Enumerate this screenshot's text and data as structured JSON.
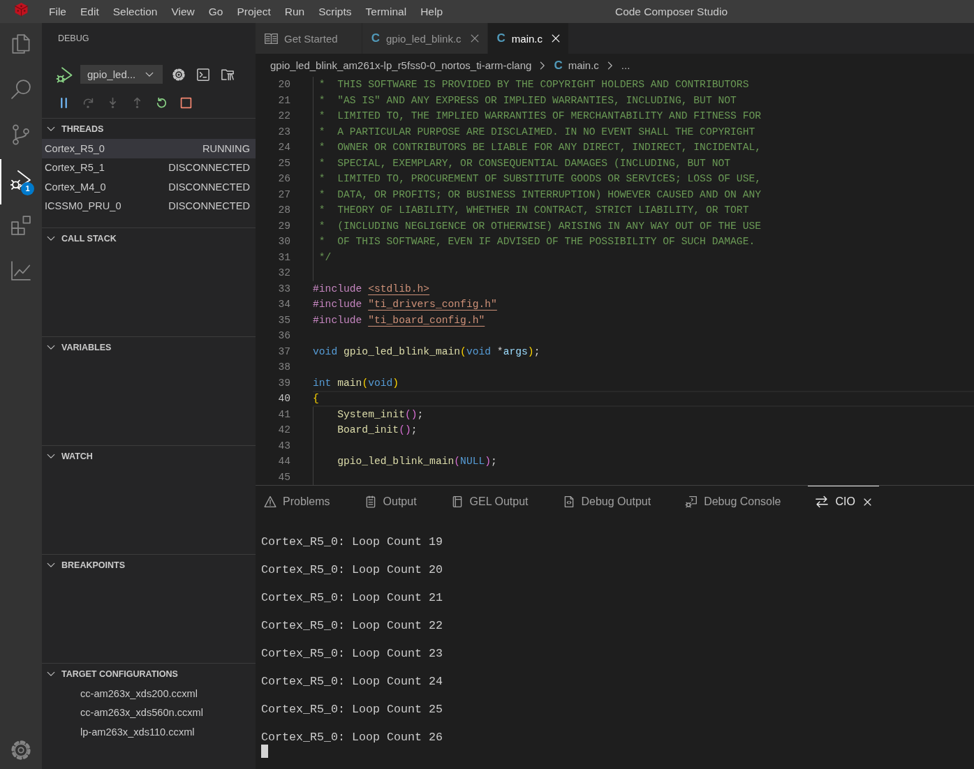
{
  "window": {
    "title": "Code Composer Studio"
  },
  "menu": [
    "File",
    "Edit",
    "Selection",
    "View",
    "Go",
    "Project",
    "Run",
    "Scripts",
    "Terminal",
    "Help"
  ],
  "activity_bar": {
    "items": [
      {
        "kind": "explorer",
        "selected": false
      },
      {
        "kind": "search",
        "selected": false
      },
      {
        "kind": "source-control",
        "selected": false
      },
      {
        "kind": "debug",
        "selected": true,
        "badge": "1"
      },
      {
        "kind": "extensions",
        "selected": false
      },
      {
        "kind": "chart",
        "selected": false
      }
    ]
  },
  "sidebar": {
    "title": "DEBUG",
    "launch_config": "gpio_led...",
    "actions": [
      {
        "kind": "pause",
        "disabled": false
      },
      {
        "kind": "step-over",
        "disabled": true
      },
      {
        "kind": "step-into",
        "disabled": true
      },
      {
        "kind": "step-out",
        "disabled": true
      },
      {
        "kind": "restart",
        "disabled": false
      },
      {
        "kind": "stop",
        "disabled": false
      }
    ],
    "sections": [
      {
        "title": "THREADS",
        "expanded": true,
        "threads": [
          {
            "name": "Cortex_R5_0",
            "status": "RUNNING",
            "selected": true
          },
          {
            "name": "Cortex_R5_1",
            "status": "DISCONNECTED",
            "selected": false
          },
          {
            "name": "Cortex_M4_0",
            "status": "DISCONNECTED",
            "selected": false
          },
          {
            "name": "ICSSM0_PRU_0",
            "status": "DISCONNECTED",
            "selected": false
          }
        ]
      },
      {
        "title": "CALL STACK",
        "expanded": true
      },
      {
        "title": "VARIABLES",
        "expanded": true
      },
      {
        "title": "WATCH",
        "expanded": true
      },
      {
        "title": "BREAKPOINTS",
        "expanded": true
      },
      {
        "title": "TARGET CONFIGURATIONS",
        "expanded": true,
        "items": [
          "cc-am263x_xds200.ccxml",
          "cc-am263x_xds560n.ccxml",
          "lp-am263x_xds110.ccxml"
        ]
      }
    ]
  },
  "editor": {
    "tabs": [
      {
        "kind": "preview",
        "label": "Get Started",
        "selected": false,
        "closable": false
      },
      {
        "kind": "c-file",
        "icon": "C",
        "label": "gpio_led_blink.c",
        "selected": false,
        "closable": true
      },
      {
        "kind": "c-file",
        "icon": "C",
        "label": "main.c",
        "selected": true,
        "closable": true
      }
    ],
    "breadcrumb": [
      {
        "text": "gpio_led_blink_am261x-lp_r5fss0-0_nortos_ti-arm-clang"
      },
      {
        "icon": "C",
        "text": "main.c"
      },
      {
        "text": "..."
      }
    ],
    "lines": [
      {
        "number": "20",
        "guide": true,
        "current": false,
        "tokens": [
          {
            "kind": "comment",
            "text": " *  THIS SOFTWARE IS PROVIDED BY THE COPYRIGHT HOLDERS AND CONTRIBUTORS"
          }
        ]
      },
      {
        "number": "21",
        "guide": true,
        "current": false,
        "tokens": [
          {
            "kind": "comment",
            "text": " *  \"AS IS\" AND ANY EXPRESS OR IMPLIED WARRANTIES, INCLUDING, BUT NOT"
          }
        ]
      },
      {
        "number": "22",
        "guide": true,
        "current": false,
        "tokens": [
          {
            "kind": "comment",
            "text": " *  LIMITED TO, THE IMPLIED WARRANTIES OF MERCHANTABILITY AND FITNESS FOR"
          }
        ]
      },
      {
        "number": "23",
        "guide": true,
        "current": false,
        "tokens": [
          {
            "kind": "comment",
            "text": " *  A PARTICULAR PURPOSE ARE DISCLAIMED. IN NO EVENT SHALL THE COPYRIGHT"
          }
        ]
      },
      {
        "number": "24",
        "guide": true,
        "current": false,
        "tokens": [
          {
            "kind": "comment",
            "text": " *  OWNER OR CONTRIBUTORS BE LIABLE FOR ANY DIRECT, INDIRECT, INCIDENTAL,"
          }
        ]
      },
      {
        "number": "25",
        "guide": true,
        "current": false,
        "tokens": [
          {
            "kind": "comment",
            "text": " *  SPECIAL, EXEMPLARY, OR CONSEQUENTIAL DAMAGES (INCLUDING, BUT NOT"
          }
        ]
      },
      {
        "number": "26",
        "guide": true,
        "current": false,
        "tokens": [
          {
            "kind": "comment",
            "text": " *  LIMITED TO, PROCUREMENT OF SUBSTITUTE GOODS OR SERVICES; LOSS OF USE,"
          }
        ]
      },
      {
        "number": "27",
        "guide": true,
        "current": false,
        "tokens": [
          {
            "kind": "comment",
            "text": " *  DATA, OR PROFITS; OR BUSINESS INTERRUPTION) HOWEVER CAUSED AND ON ANY"
          }
        ]
      },
      {
        "number": "28",
        "guide": true,
        "current": false,
        "tokens": [
          {
            "kind": "comment",
            "text": " *  THEORY OF LIABILITY, WHETHER IN CONTRACT, STRICT LIABILITY, OR TORT"
          }
        ]
      },
      {
        "number": "29",
        "guide": true,
        "current": false,
        "tokens": [
          {
            "kind": "comment",
            "text": " *  (INCLUDING NEGLIGENCE OR OTHERWISE) ARISING IN ANY WAY OUT OF THE USE"
          }
        ]
      },
      {
        "number": "30",
        "guide": true,
        "current": false,
        "tokens": [
          {
            "kind": "comment",
            "text": " *  OF THIS SOFTWARE, EVEN IF ADVISED OF THE POSSIBILITY OF SUCH DAMAGE."
          }
        ]
      },
      {
        "number": "31",
        "guide": true,
        "current": false,
        "tokens": [
          {
            "kind": "comment",
            "text": " */"
          }
        ]
      },
      {
        "number": "32",
        "guide": true,
        "current": false
      },
      {
        "number": "33",
        "guide": false,
        "current": false,
        "tokens": [
          {
            "kind": "directive",
            "text": "#include "
          },
          {
            "kind": "include-path",
            "text": "<stdlib.h>"
          }
        ]
      },
      {
        "number": "34",
        "guide": false,
        "current": false,
        "tokens": [
          {
            "kind": "directive",
            "text": "#include "
          },
          {
            "kind": "include-path",
            "text": "\"ti_drivers_config.h\""
          }
        ]
      },
      {
        "number": "35",
        "guide": false,
        "current": false,
        "tokens": [
          {
            "kind": "directive",
            "text": "#include "
          },
          {
            "kind": "include-path",
            "text": "\"ti_board_config.h\""
          }
        ]
      },
      {
        "number": "36",
        "guide": false,
        "current": false
      },
      {
        "number": "37",
        "guide": false,
        "current": false,
        "tokens": [
          {
            "kind": "type",
            "text": "void "
          },
          {
            "kind": "function",
            "text": "gpio_led_blink_main"
          },
          {
            "kind": "bracket",
            "text": "("
          },
          {
            "kind": "type",
            "text": "void"
          },
          {
            "kind": "plain",
            "text": " *"
          },
          {
            "kind": "param",
            "text": "args"
          },
          {
            "kind": "bracket",
            "text": ")"
          },
          {
            "kind": "plain",
            "text": ";"
          }
        ]
      },
      {
        "number": "38",
        "guide": false,
        "current": false
      },
      {
        "number": "39",
        "guide": false,
        "current": false,
        "tokens": [
          {
            "kind": "type",
            "text": "int "
          },
          {
            "kind": "function",
            "text": "main"
          },
          {
            "kind": "bracket",
            "text": "("
          },
          {
            "kind": "type",
            "text": "void"
          },
          {
            "kind": "bracket",
            "text": ")"
          }
        ]
      },
      {
        "number": "40",
        "guide": false,
        "current": true,
        "tokens": [
          {
            "kind": "bracket",
            "text": "{"
          }
        ]
      },
      {
        "number": "41",
        "guide": true,
        "current": false,
        "tokens": [
          {
            "kind": "function",
            "text": "    System_init"
          },
          {
            "kind": "bracket2",
            "text": "()"
          },
          {
            "kind": "plain",
            "text": ";"
          }
        ]
      },
      {
        "number": "42",
        "guide": true,
        "current": false,
        "tokens": [
          {
            "kind": "function",
            "text": "    Board_init"
          },
          {
            "kind": "bracket2",
            "text": "()"
          },
          {
            "kind": "plain",
            "text": ";"
          }
        ]
      },
      {
        "number": "43",
        "guide": true,
        "current": false
      },
      {
        "number": "44",
        "guide": true,
        "current": false,
        "tokens": [
          {
            "kind": "function",
            "text": "    gpio_led_blink_main"
          },
          {
            "kind": "bracket2",
            "text": "("
          },
          {
            "kind": "constant",
            "text": "NULL"
          },
          {
            "kind": "bracket2",
            "text": ")"
          },
          {
            "kind": "plain",
            "text": ";"
          }
        ]
      },
      {
        "number": "45",
        "guide": true,
        "current": false
      }
    ]
  },
  "panel": {
    "tabs": [
      {
        "kind": "problems",
        "label": "Problems",
        "selected": false,
        "closable": false
      },
      {
        "kind": "output",
        "label": "Output",
        "selected": false,
        "closable": false
      },
      {
        "kind": "gel-output",
        "label": "GEL Output",
        "selected": false,
        "closable": false
      },
      {
        "kind": "debug-output",
        "label": "Debug Output",
        "selected": false,
        "closable": false
      },
      {
        "kind": "debug-console",
        "label": "Debug Console",
        "selected": false,
        "closable": false
      },
      {
        "kind": "cio",
        "label": "CIO",
        "selected": true,
        "closable": true
      }
    ],
    "output": [
      "Cortex_R5_0: Loop Count 19",
      "Cortex_R5_0: Loop Count 20",
      "Cortex_R5_0: Loop Count 21",
      "Cortex_R5_0: Loop Count 22",
      "Cortex_R5_0: Loop Count 23",
      "Cortex_R5_0: Loop Count 24",
      "Cortex_R5_0: Loop Count 25",
      "Cortex_R5_0: Loop Count 26"
    ],
    "cursor": true
  }
}
